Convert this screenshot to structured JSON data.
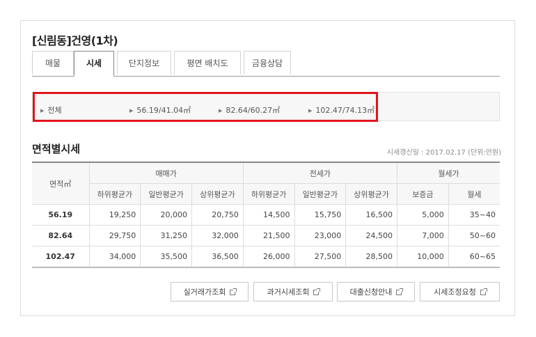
{
  "complex_title": "[신림동]건영(1차)",
  "tabs": [
    {
      "label": "매물",
      "active": false
    },
    {
      "label": "시세",
      "active": true
    },
    {
      "label": "단지정보",
      "active": false
    },
    {
      "label": "평면 배치도",
      "active": false
    },
    {
      "label": "금융상담",
      "active": false
    }
  ],
  "area_filter": {
    "items": [
      "전체",
      "56.19/41.04㎡",
      "82.64/60.27㎡",
      "102.47/74.13㎡"
    ],
    "highlight_color": "#e1141b"
  },
  "section_title": "면적별시세",
  "update_note": "시세갱신일 : 2017.02.17 (단위:만원)",
  "table": {
    "area_header": "면적㎡",
    "group_headers": [
      "매매가",
      "전세가",
      "월세가"
    ],
    "sub_headers": [
      "하위평균가",
      "일반평균가",
      "상위평균가",
      "하위평균가",
      "일반평균가",
      "상위평균가",
      "보증금",
      "월세"
    ],
    "rows": [
      {
        "area": "56.19",
        "values": [
          "19,250",
          "20,000",
          "20,750",
          "14,500",
          "15,750",
          "16,500",
          "5,000",
          "35~40"
        ]
      },
      {
        "area": "82.64",
        "values": [
          "29,750",
          "31,250",
          "32,000",
          "21,500",
          "23,000",
          "24,500",
          "7,000",
          "50~60"
        ]
      },
      {
        "area": "102.47",
        "values": [
          "34,000",
          "35,500",
          "36,500",
          "26,000",
          "27,500",
          "28,500",
          "10,000",
          "60~65"
        ]
      }
    ]
  },
  "buttons": [
    "실거래가조회",
    "과거시세조회",
    "대출신청안내",
    "시세조정요청"
  ]
}
